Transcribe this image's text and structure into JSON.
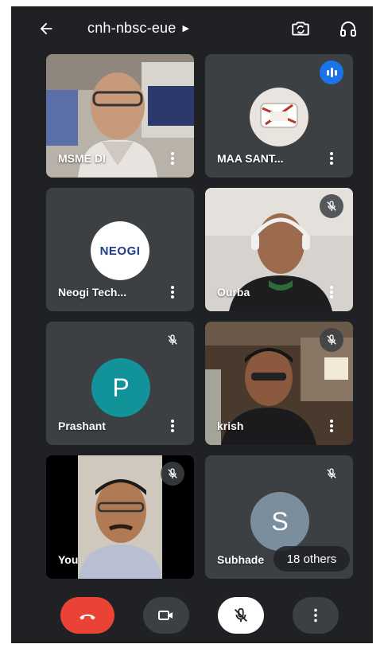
{
  "meeting": {
    "code": "cnh-nbsc-eue"
  },
  "participants": [
    {
      "name": "MSME DI",
      "state": "video"
    },
    {
      "name": "MAA SANT...",
      "state": "speaking"
    },
    {
      "name": "Neogi Tech...",
      "logo_text": "NEOGI"
    },
    {
      "name": "Ourba",
      "state": "muted"
    },
    {
      "name": "Prashant",
      "initial": "P",
      "avatar_color": "#12939a",
      "state": "muted"
    },
    {
      "name": "krish",
      "state": "muted"
    },
    {
      "name": "You",
      "state": "muted"
    },
    {
      "name": "Subhade",
      "initial": "S",
      "avatar_color": "#7a8e9e",
      "state": "muted"
    }
  ],
  "others_chip": "18 others",
  "colors": {
    "background": "#202124",
    "tile": "#3c4043",
    "end_call": "#ea4335",
    "speaking": "#1a73e8"
  },
  "icons": {
    "back": "arrow-left-icon",
    "switch_camera": "switch-camera-icon",
    "audio": "headphones-icon",
    "end_call": "phone-hangup-icon",
    "camera": "video-camera-icon",
    "mic": "mic-off-icon",
    "more": "more-vert-icon"
  }
}
